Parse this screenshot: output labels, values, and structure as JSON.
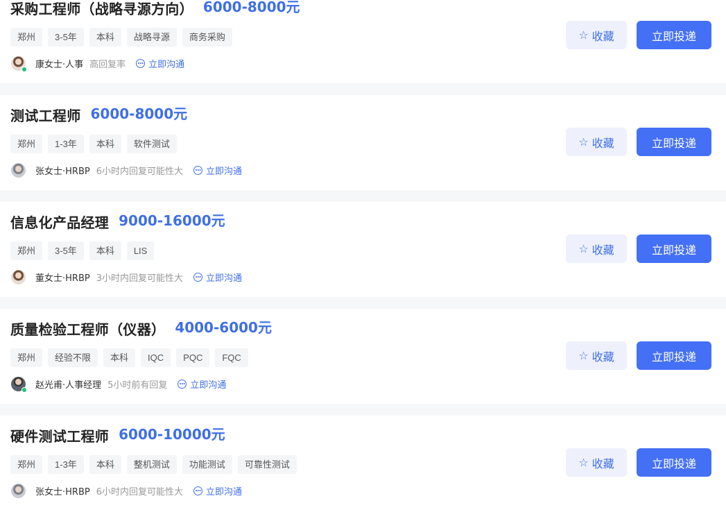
{
  "jobs": [
    {
      "title": "采购工程师（战略寻源方向）",
      "salary": "6000-8000元",
      "tags": [
        "郑州",
        "3-5年",
        "本科",
        "战略寻源",
        "商务采购"
      ],
      "recruiter": "康女士·人事",
      "reply": "高回复率",
      "chat": "立即沟通",
      "fav": "收藏",
      "apply": "立即投递",
      "avatar": "female",
      "online": true
    },
    {
      "title": "测试工程师",
      "salary": "6000-8000元",
      "tags": [
        "郑州",
        "1-3年",
        "本科",
        "软件测试"
      ],
      "recruiter": "张女士·HRBP",
      "reply": "6小时内回复可能性大",
      "chat": "立即沟通",
      "fav": "收藏",
      "apply": "立即投递",
      "avatar": "grey",
      "online": false
    },
    {
      "title": "信息化产品经理",
      "salary": "9000-16000元",
      "tags": [
        "郑州",
        "3-5年",
        "本科",
        "LIS"
      ],
      "recruiter": "董女士·HRBP",
      "reply": "3小时内回复可能性大",
      "chat": "立即沟通",
      "fav": "收藏",
      "apply": "立即投递",
      "avatar": "female",
      "online": false
    },
    {
      "title": "质量检验工程师（仪器）",
      "salary": "4000-6000元",
      "tags": [
        "郑州",
        "经验不限",
        "本科",
        "IQC",
        "PQC",
        "FQC"
      ],
      "recruiter": "赵光甫·人事经理",
      "reply": "5小时前有回复",
      "chat": "立即沟通",
      "fav": "收藏",
      "apply": "立即投递",
      "avatar": "male",
      "online": true
    },
    {
      "title": "硬件测试工程师",
      "salary": "6000-10000元",
      "tags": [
        "郑州",
        "1-3年",
        "本科",
        "整机测试",
        "功能测试",
        "可靠性测试"
      ],
      "recruiter": "张女士·HRBP",
      "reply": "6小时内回复可能性大",
      "chat": "立即沟通",
      "fav": "收藏",
      "apply": "立即投递",
      "avatar": "grey",
      "online": false
    }
  ],
  "colors": {
    "accent": "#3f6fe6",
    "apply_bg": "#4470f5",
    "fav_bg": "#eef1fc",
    "tag_bg": "#f4f5f7",
    "online": "#1ec27a"
  },
  "icons": {
    "fav": "star-outline-icon",
    "chat": "chat-bubble-icon"
  }
}
